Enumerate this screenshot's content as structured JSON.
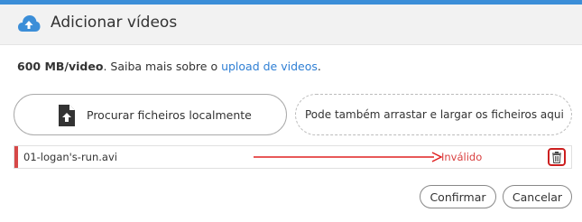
{
  "dialog": {
    "title": "Adicionar vídeos",
    "header_icon": "cloud-upload-icon"
  },
  "info": {
    "size_limit": "600 MB/video",
    "text": ". Saiba mais sobre o ",
    "link": "upload de videos",
    "end": "."
  },
  "browse": {
    "label": "Procurar ficheiros localmente",
    "icon": "file-upload-icon"
  },
  "dropzone": {
    "label": "Pode também arrastar e largar os ficheiros aqui"
  },
  "files": [
    {
      "name": "01-logan's-run.avi",
      "status": "Inválido",
      "status_color": "#d94040"
    }
  ],
  "annotation": {
    "arrow_color": "#e02020",
    "highlight_color": "#cc1f1f"
  },
  "actions": {
    "confirm": "Confirmar",
    "cancel": "Cancelar"
  },
  "colors": {
    "accent": "#3b8ed8",
    "link": "#2f7fd4",
    "error": "#d64848"
  }
}
